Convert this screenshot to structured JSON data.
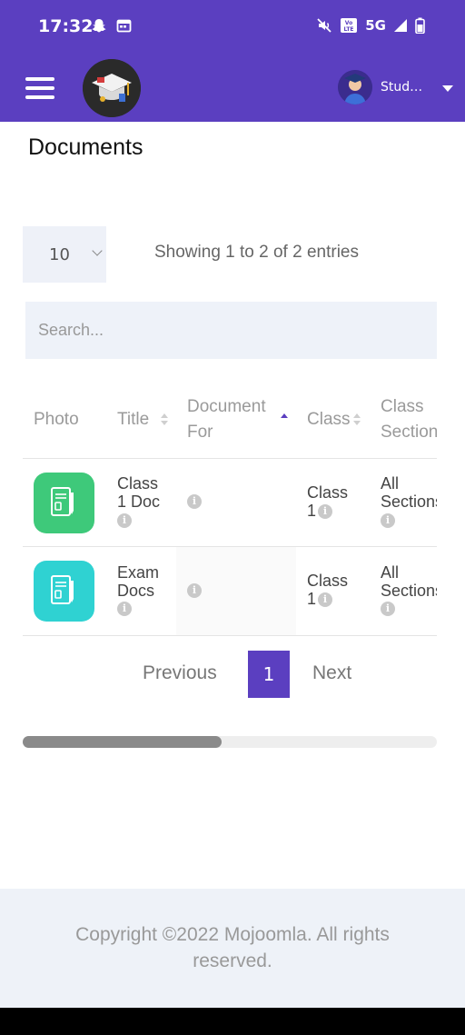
{
  "status_bar": {
    "time": "17:32",
    "network": "5G"
  },
  "app_bar": {
    "user_name": "Student"
  },
  "page": {
    "title": "Documents"
  },
  "table_controls": {
    "page_length": "10",
    "info": "Showing 1 to 2 of 2 entries",
    "search_placeholder": "Search..."
  },
  "table": {
    "columns": [
      "Photo",
      "Title",
      "Document For",
      "Class",
      "Class Section"
    ],
    "rows": [
      {
        "thumb_color": "#3ec97a",
        "title": "Class 1 Doc",
        "document_for": "",
        "class": "Class 1",
        "section": "All Sections"
      },
      {
        "thumb_color": "#2fd2d2",
        "title": "Exam Docs",
        "document_for": "",
        "class": "Class 1",
        "section": "All Sections"
      }
    ]
  },
  "pagination": {
    "previous": "Previous",
    "current": "1",
    "next": "Next"
  },
  "scrollbar": {
    "position": 0.48
  },
  "footer": {
    "copyright": "Copyright ©2022 Mojoomla. All rights reserved."
  },
  "colors": {
    "primary": "#5b3fc0",
    "status_bar": "#5b3fc0"
  }
}
